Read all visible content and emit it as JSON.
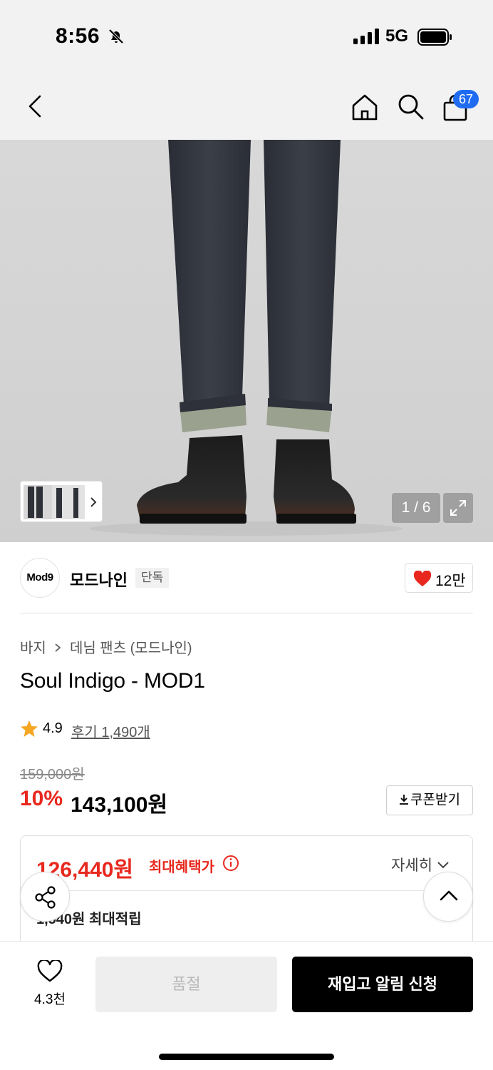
{
  "status_bar": {
    "time": "8:56",
    "network": "5G"
  },
  "nav": {
    "cart_count": "67"
  },
  "gallery": {
    "counter": "1 / 6"
  },
  "brand": {
    "logo_text": "Mod9",
    "name": "모드나인",
    "tag": "단독",
    "likes": "12만"
  },
  "breadcrumb": {
    "category": "바지",
    "subcategory": "데님 팬츠 (모드나인)"
  },
  "product": {
    "title": "Soul Indigo - MOD1",
    "rating": "4.9",
    "reviews": "후기 1,490개",
    "original_price": "159,000원",
    "discount": "10%",
    "sale_price": "143,100원",
    "coupon_label": "쿠폰받기"
  },
  "benefit": {
    "price": "126,440원",
    "label": "최대혜택가",
    "detail_label": "자세히",
    "points": "1,540원 최대적립"
  },
  "bottom": {
    "wish_count": "4.3천",
    "soldout_label": "품절",
    "notify_label": "재입고 알림 신청"
  },
  "colors": {
    "accent_red": "#e8281e",
    "badge_blue": "#1f6cf2",
    "heart": "#e8281e"
  }
}
